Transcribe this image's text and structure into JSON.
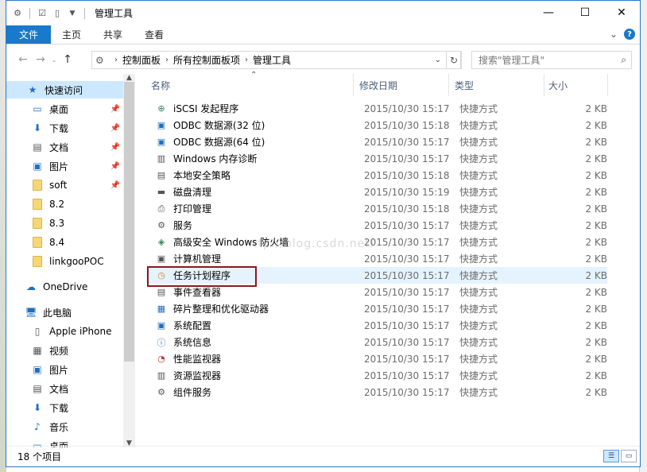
{
  "window": {
    "title": "管理工具",
    "controls": {
      "minimize": "—",
      "maximize": "☐",
      "close": "✕"
    }
  },
  "ribbon": {
    "tabs": [
      "文件",
      "主页",
      "共享",
      "查看"
    ],
    "expand": "⌄",
    "help": "?"
  },
  "address": {
    "crumbs": [
      "控制面板",
      "所有控制面板项",
      "管理工具"
    ],
    "search_placeholder": "搜索\"管理工具\""
  },
  "nav": {
    "quick_access": "快速访问",
    "items": [
      {
        "label": "桌面",
        "icon": "desktop-icon",
        "pinned": true
      },
      {
        "label": "下载",
        "icon": "download-icon",
        "pinned": true
      },
      {
        "label": "文档",
        "icon": "document-icon",
        "pinned": true
      },
      {
        "label": "图片",
        "icon": "pictures-icon",
        "pinned": true
      },
      {
        "label": "soft",
        "icon": "folder-icon",
        "pinned": true
      },
      {
        "label": "8.2",
        "icon": "folder-icon",
        "pinned": false
      },
      {
        "label": "8.3",
        "icon": "folder-icon",
        "pinned": false
      },
      {
        "label": "8.4",
        "icon": "folder-icon",
        "pinned": false
      },
      {
        "label": "linkgooPOC",
        "icon": "folder-icon",
        "pinned": false
      }
    ],
    "onedrive": "OneDrive",
    "this_pc": "此电脑",
    "pc_items": [
      {
        "label": "Apple iPhone",
        "icon": "phone-icon"
      },
      {
        "label": "视频",
        "icon": "video-icon"
      },
      {
        "label": "图片",
        "icon": "pictures-icon"
      },
      {
        "label": "文档",
        "icon": "document-icon"
      },
      {
        "label": "下载",
        "icon": "download-icon"
      },
      {
        "label": "音乐",
        "icon": "music-icon"
      },
      {
        "label": "桌面",
        "icon": "desktop-icon"
      }
    ]
  },
  "columns": {
    "name": "名称",
    "date": "修改日期",
    "type": "类型",
    "size": "大小"
  },
  "files": [
    {
      "name": "iSCSI 发起程序",
      "date": "2015/10/30 15:17",
      "type": "快捷方式",
      "size": "2 KB",
      "icon": "iscsi-icon"
    },
    {
      "name": "ODBC 数据源(32 位)",
      "date": "2015/10/30 15:18",
      "type": "快捷方式",
      "size": "2 KB",
      "icon": "odbc-icon"
    },
    {
      "name": "ODBC 数据源(64 位)",
      "date": "2015/10/30 15:17",
      "type": "快捷方式",
      "size": "2 KB",
      "icon": "odbc-icon"
    },
    {
      "name": "Windows 内存诊断",
      "date": "2015/10/30 15:17",
      "type": "快捷方式",
      "size": "2 KB",
      "icon": "memory-icon"
    },
    {
      "name": "本地安全策略",
      "date": "2015/10/30 15:18",
      "type": "快捷方式",
      "size": "2 KB",
      "icon": "security-policy-icon"
    },
    {
      "name": "磁盘清理",
      "date": "2015/10/30 15:19",
      "type": "快捷方式",
      "size": "2 KB",
      "icon": "disk-cleanup-icon"
    },
    {
      "name": "打印管理",
      "date": "2015/10/30 15:18",
      "type": "快捷方式",
      "size": "2 KB",
      "icon": "print-icon"
    },
    {
      "name": "服务",
      "date": "2015/10/30 15:17",
      "type": "快捷方式",
      "size": "2 KB",
      "icon": "services-icon"
    },
    {
      "name": "高级安全 Windows 防火墙",
      "date": "2015/10/30 15:17",
      "type": "快捷方式",
      "size": "2 KB",
      "icon": "firewall-icon"
    },
    {
      "name": "计算机管理",
      "date": "2015/10/30 15:17",
      "type": "快捷方式",
      "size": "2 KB",
      "icon": "computer-mgmt-icon"
    },
    {
      "name": "任务计划程序",
      "date": "2015/10/30 15:17",
      "type": "快捷方式",
      "size": "2 KB",
      "icon": "task-scheduler-icon"
    },
    {
      "name": "事件查看器",
      "date": "2015/10/30 15:17",
      "type": "快捷方式",
      "size": "2 KB",
      "icon": "event-viewer-icon"
    },
    {
      "name": "碎片整理和优化驱动器",
      "date": "2015/10/30 15:17",
      "type": "快捷方式",
      "size": "2 KB",
      "icon": "defrag-icon"
    },
    {
      "name": "系统配置",
      "date": "2015/10/30 15:17",
      "type": "快捷方式",
      "size": "2 KB",
      "icon": "msconfig-icon"
    },
    {
      "name": "系统信息",
      "date": "2015/10/30 15:17",
      "type": "快捷方式",
      "size": "2 KB",
      "icon": "sysinfo-icon"
    },
    {
      "name": "性能监视器",
      "date": "2015/10/30 15:17",
      "type": "快捷方式",
      "size": "2 KB",
      "icon": "perfmon-icon"
    },
    {
      "name": "资源监视器",
      "date": "2015/10/30 15:17",
      "type": "快捷方式",
      "size": "2 KB",
      "icon": "resmon-icon"
    },
    {
      "name": "组件服务",
      "date": "2015/10/30 15:17",
      "type": "快捷方式",
      "size": "2 KB",
      "icon": "component-services-icon"
    }
  ],
  "status": {
    "count": "18 个项目"
  },
  "watermark": "http://blog.csdn.net/"
}
